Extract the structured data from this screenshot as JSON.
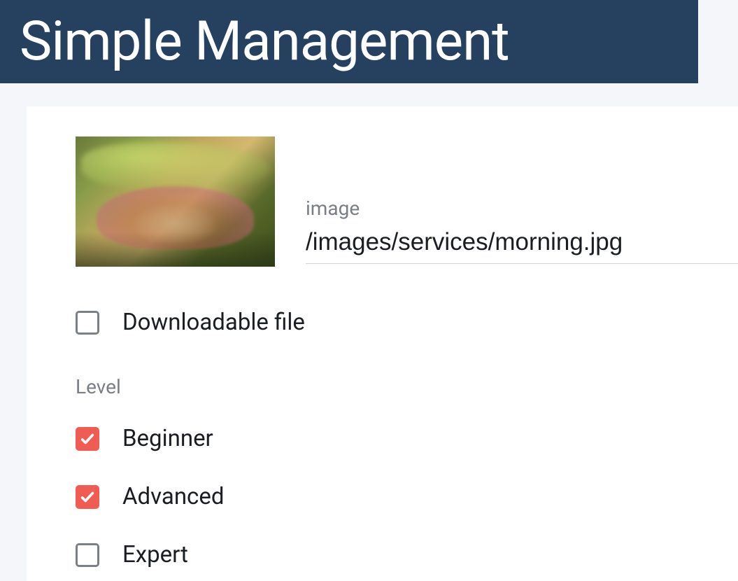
{
  "header": {
    "title": "Simple Management"
  },
  "form": {
    "image_field": {
      "label": "image",
      "value": "/images/services/morning.jpg"
    },
    "downloadable": {
      "label": "Downloadable file",
      "checked": false
    },
    "level": {
      "title": "Level",
      "options": [
        {
          "label": "Beginner",
          "checked": true
        },
        {
          "label": "Advanced",
          "checked": true
        },
        {
          "label": "Expert",
          "checked": false
        }
      ]
    }
  }
}
